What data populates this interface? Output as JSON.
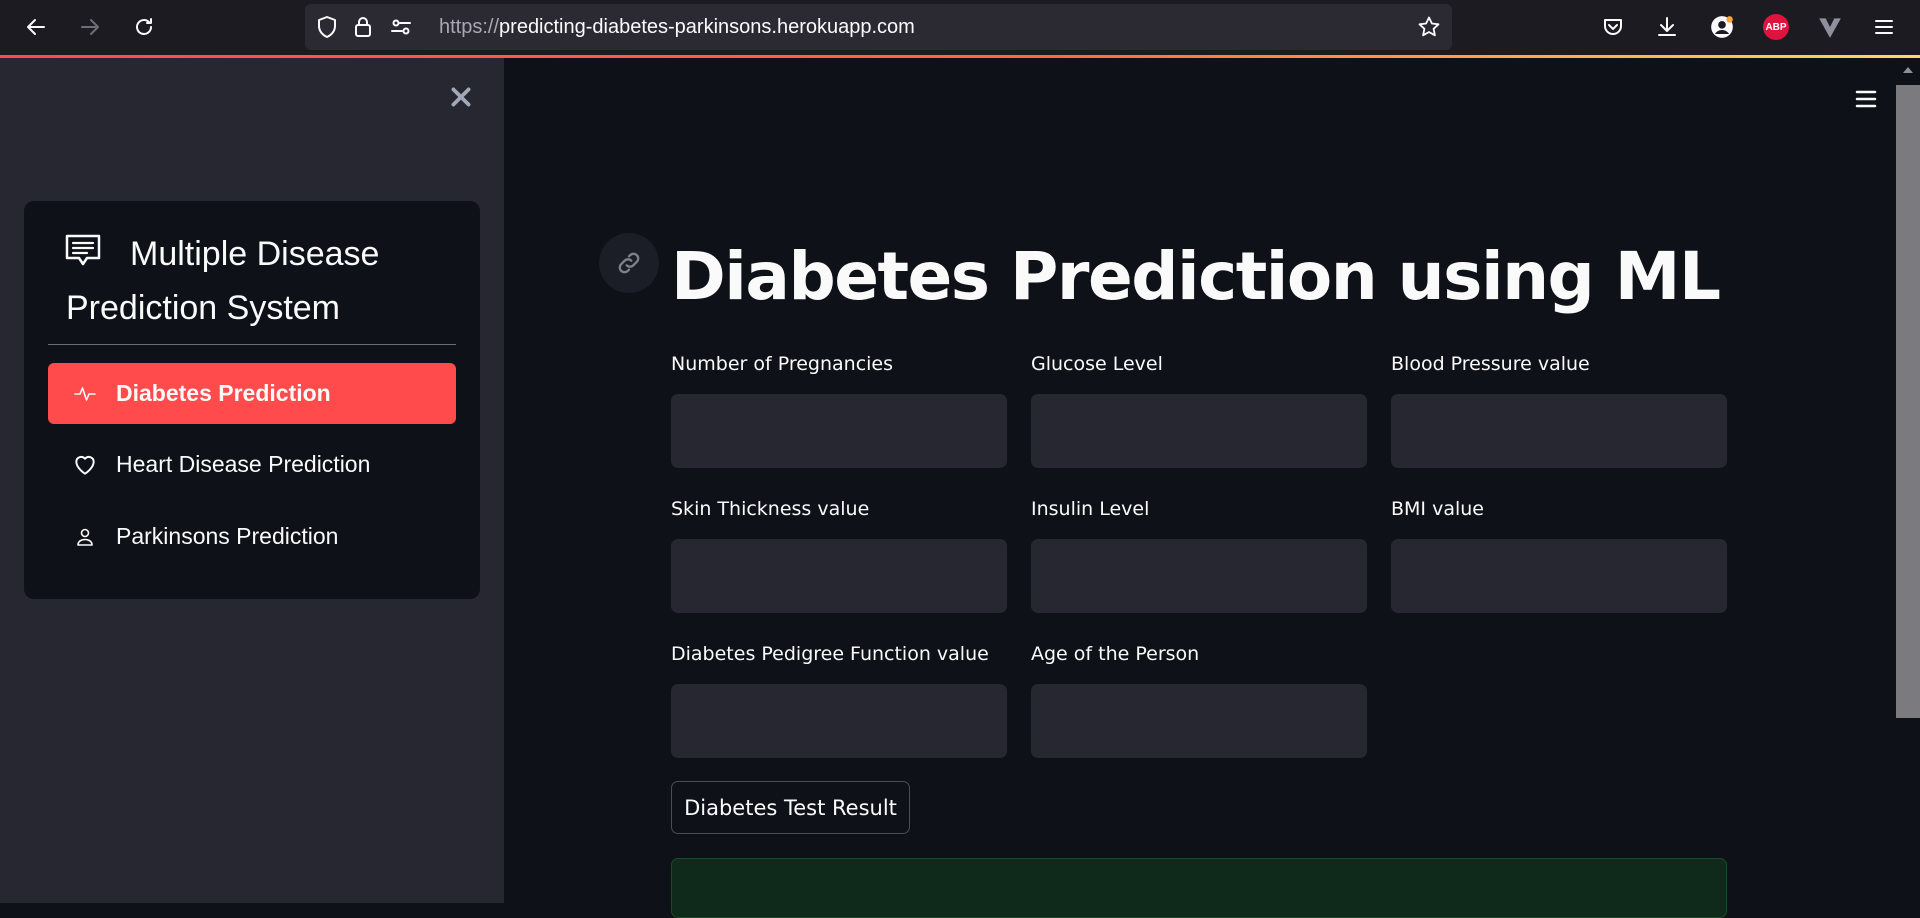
{
  "browser": {
    "url_scheme": "https://",
    "url_host": "predicting-diabetes-parkinsons.herokuapp.com",
    "abp_label": "ABP"
  },
  "sidebar": {
    "title": "Multiple Disease Prediction System",
    "accent_color": "#ff4b4b",
    "items": [
      {
        "label": "Diabetes Prediction",
        "icon": "activity-icon",
        "active": true
      },
      {
        "label": "Heart Disease Prediction",
        "icon": "heart-icon",
        "active": false
      },
      {
        "label": "Parkinsons Prediction",
        "icon": "person-icon",
        "active": false
      }
    ]
  },
  "main": {
    "title": "Diabetes Prediction using ML",
    "fields": [
      {
        "label": "Number of Pregnancies",
        "value": ""
      },
      {
        "label": "Glucose Level",
        "value": ""
      },
      {
        "label": "Blood Pressure value",
        "value": ""
      },
      {
        "label": "Skin Thickness value",
        "value": ""
      },
      {
        "label": "Insulin Level",
        "value": ""
      },
      {
        "label": "BMI value",
        "value": ""
      },
      {
        "label": "Diabetes Pedigree Function value",
        "value": ""
      },
      {
        "label": "Age of the Person",
        "value": ""
      }
    ],
    "submit_label": "Diabetes Test Result",
    "result_text": ""
  }
}
